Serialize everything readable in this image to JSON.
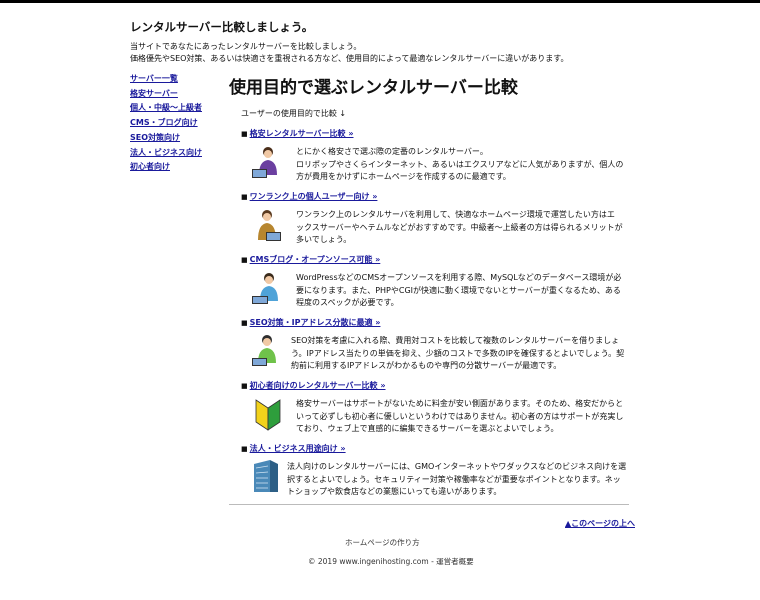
{
  "site": {
    "title": "レンタルサーバー比較しましょう。",
    "intro_line1": "当サイトであなたにあったレンタルサーバーを比較しましょう。",
    "intro_line2": "価格優先やSEO対策、あるいは快適さを重視される方など、使用目的によって最適なレンタルサーバーに違いがあります。"
  },
  "sidebar": {
    "items": [
      {
        "label": "サーバー一覧"
      },
      {
        "label": "格安サーバー"
      },
      {
        "label": "個人・中級～上級者"
      },
      {
        "label": "CMS・ブログ向け"
      },
      {
        "label": "SEO対策向け"
      },
      {
        "label": "法人・ビジネス向け"
      },
      {
        "label": "初心者向け"
      }
    ]
  },
  "main": {
    "title": "使用目的で選ぶレンタルサーバー比較",
    "lead": "ユーザーの使用目的で比較 ↓",
    "bullet": "■",
    "sections": [
      {
        "heading": "格安レンタルサーバー比較 »",
        "lines": [
          "とにかく格安さで選ぶ際の定番のレンタルサーバー。",
          "ロリポップやさくらインターネット、あるいはエクスリアなどに人気がありますが、個人の",
          "方が費用をかけずにホームページを作成するのに最適です。"
        ],
        "icon": "person-laptop-icon"
      },
      {
        "heading": "ワンランク上の個人ユーザー向け »",
        "lines": [
          "ワンランク上のレンタルサーバを利用して、快適なホームページ環境で運営したい方はエ",
          "ックスサーバーやヘテムルなどがおすすめです。中級者～上級者の方は得られるメリットが",
          "多いでしょう。"
        ],
        "icon": "person-laptop-icon"
      },
      {
        "heading": "CMSブログ・オープンソース可能 »",
        "lines": [
          "WordPressなどのCMSオープンソースを利用する際、MySQLなどのデータベース環境が必",
          "要になります。また、PHPやCGIが快適に動く環境でないとサーバーが重くなるため、ある",
          "程度のスペックが必要です。"
        ],
        "icon": "person-laptop-icon"
      },
      {
        "heading": "SEO対策・IPアドレス分散に最適 »",
        "lines": [
          "SEO対策を考慮に入れる際、費用対コストを比較して複数のレンタルサーバーを借りましょ",
          "う。IPアドレス当たりの単価を抑え、少額のコストで多数のIPを確保するとよいでしょう。契",
          "約前に利用するIPアドレスがわかるものや専門の分散サーバーが最適です。"
        ],
        "icon": "person-laptop-icon"
      },
      {
        "heading": "初心者向けのレンタルサーバー比較 »",
        "lines": [
          "格安サーバーはサポートがないために料金が安い側面があります。そのため、格安だからと",
          "いって必ずしも初心者に優しいというわけではありません。初心者の方はサポートが充実し",
          "ており、ウェブ上で直感的に編集できるサーバーを選ぶとよいでしょう。"
        ],
        "icon": "beginner-mark-icon"
      },
      {
        "heading": "法人・ビジネス用途向け »",
        "lines": [
          "法人向けのレンタルサーバーには、GMOインターネットやワダックスなどのビジネス向けを選",
          "択するとよいでしょう。セキュリティー対策や稼働率などが重要なポイントとなります。ネッ",
          "トショップや飲食店などの業態にいっても違いがあります。"
        ],
        "icon": "office-building-icon"
      }
    ]
  },
  "pagetop": "▲このページの上へ",
  "footer": {
    "link": "ホームページの作り方",
    "copyright": "© 2019 www.ingenihosting.com - 運営者概要"
  },
  "colors": {
    "link": "#1a1a9c",
    "text": "#111111"
  }
}
